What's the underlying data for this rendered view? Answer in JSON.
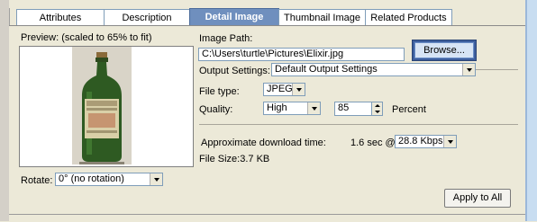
{
  "tabs": [
    {
      "label": "Attributes"
    },
    {
      "label": "Description"
    },
    {
      "label": "Detail Image"
    },
    {
      "label": "Thumbnail Image"
    },
    {
      "label": "Related Products"
    }
  ],
  "preview": {
    "label": "Preview: (scaled to 65% to fit)",
    "image_desc": "green-bottle-image"
  },
  "rotate": {
    "label": "Rotate:",
    "value": "0° (no rotation)"
  },
  "image_path": {
    "label": "Image Path:",
    "value": "C:\\Users\\turtle\\Pictures\\Elixir.jpg",
    "browse_label": "Browse..."
  },
  "output_settings": {
    "label": "Output Settings:",
    "value": "Default Output Settings"
  },
  "file_type": {
    "label": "File type:",
    "value": "JPEG"
  },
  "quality": {
    "label": "Quality:",
    "level": "High",
    "number": "85",
    "unit": "Percent"
  },
  "download": {
    "label": "Approximate download time:",
    "time": "1.6 sec @",
    "speed": "28.8 Kbps"
  },
  "file_size": "File Size:3.7 KB",
  "apply_label": "Apply to All",
  "colors": {
    "active_tab": "#6f8fbe",
    "background": "#ece9d8",
    "browse_border": "#3e5f9e"
  }
}
